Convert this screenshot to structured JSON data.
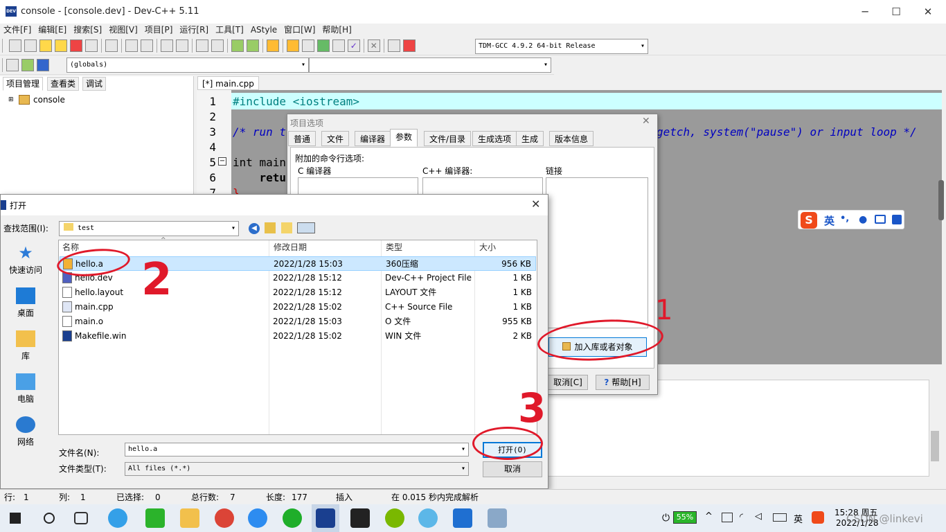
{
  "window": {
    "title": "console - [console.dev] - Dev-C++ 5.11",
    "logo": "DEV"
  },
  "menu": [
    "文件[F]",
    "编辑[E]",
    "搜索[S]",
    "视图[V]",
    "项目[P]",
    "运行[R]",
    "工具[T]",
    "AStyle",
    "窗口[W]",
    "帮助[H]"
  ],
  "compiler_select": "TDM-GCC 4.9.2 64-bit Release",
  "globals_select": "(globals)",
  "left_tabs": [
    "项目管理",
    "查看类",
    "调试"
  ],
  "project_tree": {
    "root": "console"
  },
  "editor": {
    "tab": "[*] main.cpp",
    "line_numbers": [
      "1",
      "2",
      "3",
      "4",
      "5",
      "6",
      "7"
    ],
    "lines": [
      "#include <iostream>",
      "",
      "/* run t",
      "",
      "int main",
      "    retu",
      "}"
    ],
    "comment_tail": "getch, system(\"pause\") or input loop */"
  },
  "project_dialog": {
    "title": "项目选项",
    "tabs": [
      "普通",
      "文件",
      "编译器",
      "参数",
      "文件/目录",
      "生成选项",
      "生成",
      "版本信息"
    ],
    "active_tab": "参数",
    "args_label": "附加的命令行选项:",
    "c_compiler": "C 编译器",
    "cpp_compiler": "C++ 编译器:",
    "linker": "链接",
    "add_lib_button": "加入库或者对象",
    "cancel_button": "取消[C]",
    "help_button": "帮助[H]"
  },
  "ime": {
    "lang": "英",
    "punct": "•,"
  },
  "open_dialog": {
    "title": "打开",
    "look_in_label": "查找范围(I):",
    "look_in_value": "test",
    "places": [
      "快速访问",
      "桌面",
      "库",
      "电脑",
      "网络"
    ],
    "columns": [
      "名称",
      "修改日期",
      "类型",
      "大小"
    ],
    "files": [
      {
        "name": "hello.a",
        "date": "2022/1/28 15:03",
        "type": "360压缩",
        "size": "956 KB"
      },
      {
        "name": "hello.dev",
        "date": "2022/1/28 15:12",
        "type": "Dev-C++ Project File",
        "size": "1 KB"
      },
      {
        "name": "hello.layout",
        "date": "2022/1/28 15:12",
        "type": "LAYOUT 文件",
        "size": "1 KB"
      },
      {
        "name": "main.cpp",
        "date": "2022/1/28 15:02",
        "type": "C++ Source File",
        "size": "1 KB"
      },
      {
        "name": "main.o",
        "date": "2022/1/28 15:03",
        "type": "O 文件",
        "size": "955 KB"
      },
      {
        "name": "Makefile.win",
        "date": "2022/1/28 15:02",
        "type": "WIN 文件",
        "size": "2 KB"
      }
    ],
    "filename_label": "文件名(N):",
    "filename_value": "hello.a",
    "filetype_label": "文件类型(T):",
    "filetype_value": "All files (*.*)",
    "open_button": "打开(O)",
    "cancel_button": "取消"
  },
  "status": {
    "row_label": "行:",
    "row": "1",
    "col_label": "列:",
    "col": "1",
    "sel_label": "已选择:",
    "sel": "0",
    "total_label": "总行数:",
    "total": "7",
    "len_label": "长度:",
    "len": "177",
    "mode": "插入",
    "parse": "在 0.015 秒内完成解析"
  },
  "taskbar": {
    "battery": "55%",
    "lang": "英",
    "time": "15:28 周五",
    "date": "2022/1/28",
    "watermark": "CSDN @linkevi"
  },
  "annotations": [
    "1",
    "2",
    "3"
  ],
  "colors": {
    "annotation": "#e0192a",
    "selection": "#cce8ff",
    "editor_highlight": "#ccffff"
  }
}
